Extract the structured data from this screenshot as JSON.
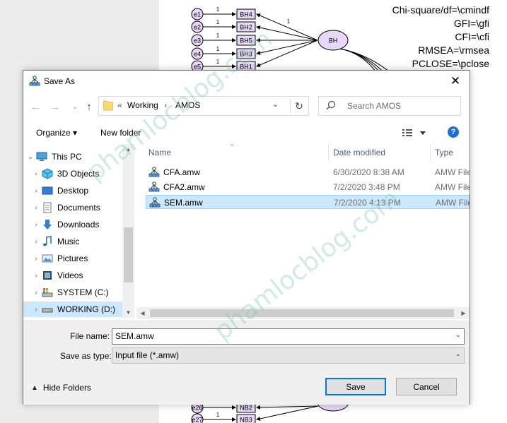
{
  "background": {
    "fit_stats": [
      "Chi-square/df=\\cmindf",
      "GFI=\\gfi",
      "CFI=\\cfi",
      "RMSEA=\\rmsea",
      "PCLOSE=\\pclose"
    ],
    "top_errors": [
      "e1",
      "e2",
      "e3",
      "e4",
      "e5"
    ],
    "top_vars": [
      "BH4",
      "BH2",
      "BH5",
      "BH3",
      "BH1"
    ],
    "path_weight": "1",
    "latent": "BH",
    "bottom_errors": [
      "e26",
      "e27"
    ],
    "bottom_vars": [
      "NB2",
      "NB3"
    ]
  },
  "dialog": {
    "title": "Save As",
    "close_glyph": "✕",
    "address": {
      "separator": "«",
      "parts": [
        "Working",
        "AMOS"
      ],
      "chevron": "›"
    },
    "search_placeholder": "Search AMOS",
    "toolbar": {
      "organize": "Organize ▾",
      "new_folder": "New folder"
    },
    "help": "?",
    "nav_items": [
      {
        "label": "This PC",
        "icon": "pc-icon"
      },
      {
        "label": "3D Objects",
        "icon": "3d-objects-icon"
      },
      {
        "label": "Desktop",
        "icon": "desktop-icon"
      },
      {
        "label": "Documents",
        "icon": "documents-icon"
      },
      {
        "label": "Downloads",
        "icon": "downloads-icon"
      },
      {
        "label": "Music",
        "icon": "music-icon"
      },
      {
        "label": "Pictures",
        "icon": "pictures-icon"
      },
      {
        "label": "Videos",
        "icon": "videos-icon"
      },
      {
        "label": "SYSTEM (C:)",
        "icon": "system-drive-icon"
      },
      {
        "label": "WORKING (D:)",
        "icon": "drive-icon"
      }
    ],
    "columns": [
      "Name",
      "Date modified",
      "Type"
    ],
    "files": [
      {
        "name": "CFA.amw",
        "date": "6/30/2020 8:38 AM",
        "type": "AMW File"
      },
      {
        "name": "CFA2.amw",
        "date": "7/2/2020 3:48 PM",
        "type": "AMW File"
      },
      {
        "name": "SEM.amw",
        "date": "7/2/2020 4:13 PM",
        "type": "AMW File"
      }
    ],
    "file_name_label": "File name:",
    "file_name_value": "SEM.amw",
    "save_type_label": "Save as type:",
    "save_type_value": "Input file (*.amw)",
    "hide_folders": "Hide Folders",
    "save_button": "Save",
    "cancel_button": "Cancel"
  },
  "watermark": "phamlocblog.com",
  "colors": {
    "selection": "#cce8ff",
    "accent": "#0078d7",
    "latent_fill": "#e8d8f8"
  }
}
